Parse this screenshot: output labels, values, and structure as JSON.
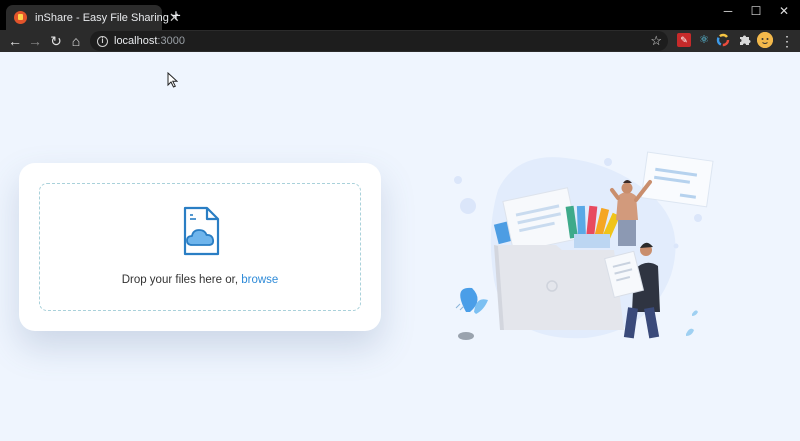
{
  "browser": {
    "tab_title": "inShare - Easy File Sharing",
    "tab_close": "✕",
    "new_tab": "+",
    "url_host": "localhost",
    "url_port": ":3000",
    "window_controls": {
      "minimize": "─",
      "maximize": "☐",
      "close": "✕"
    },
    "nav": {
      "back": "←",
      "forward": "→",
      "reload": "↻",
      "home": "⌂"
    },
    "star": "☆",
    "menu": "⋮"
  },
  "upload": {
    "drop_text": "Drop your files here or, ",
    "browse_label": "browse"
  },
  "colors": {
    "page_background": "#eff5fe",
    "accent": "#2f8bd8",
    "dashed_border": "#a9d1da"
  }
}
